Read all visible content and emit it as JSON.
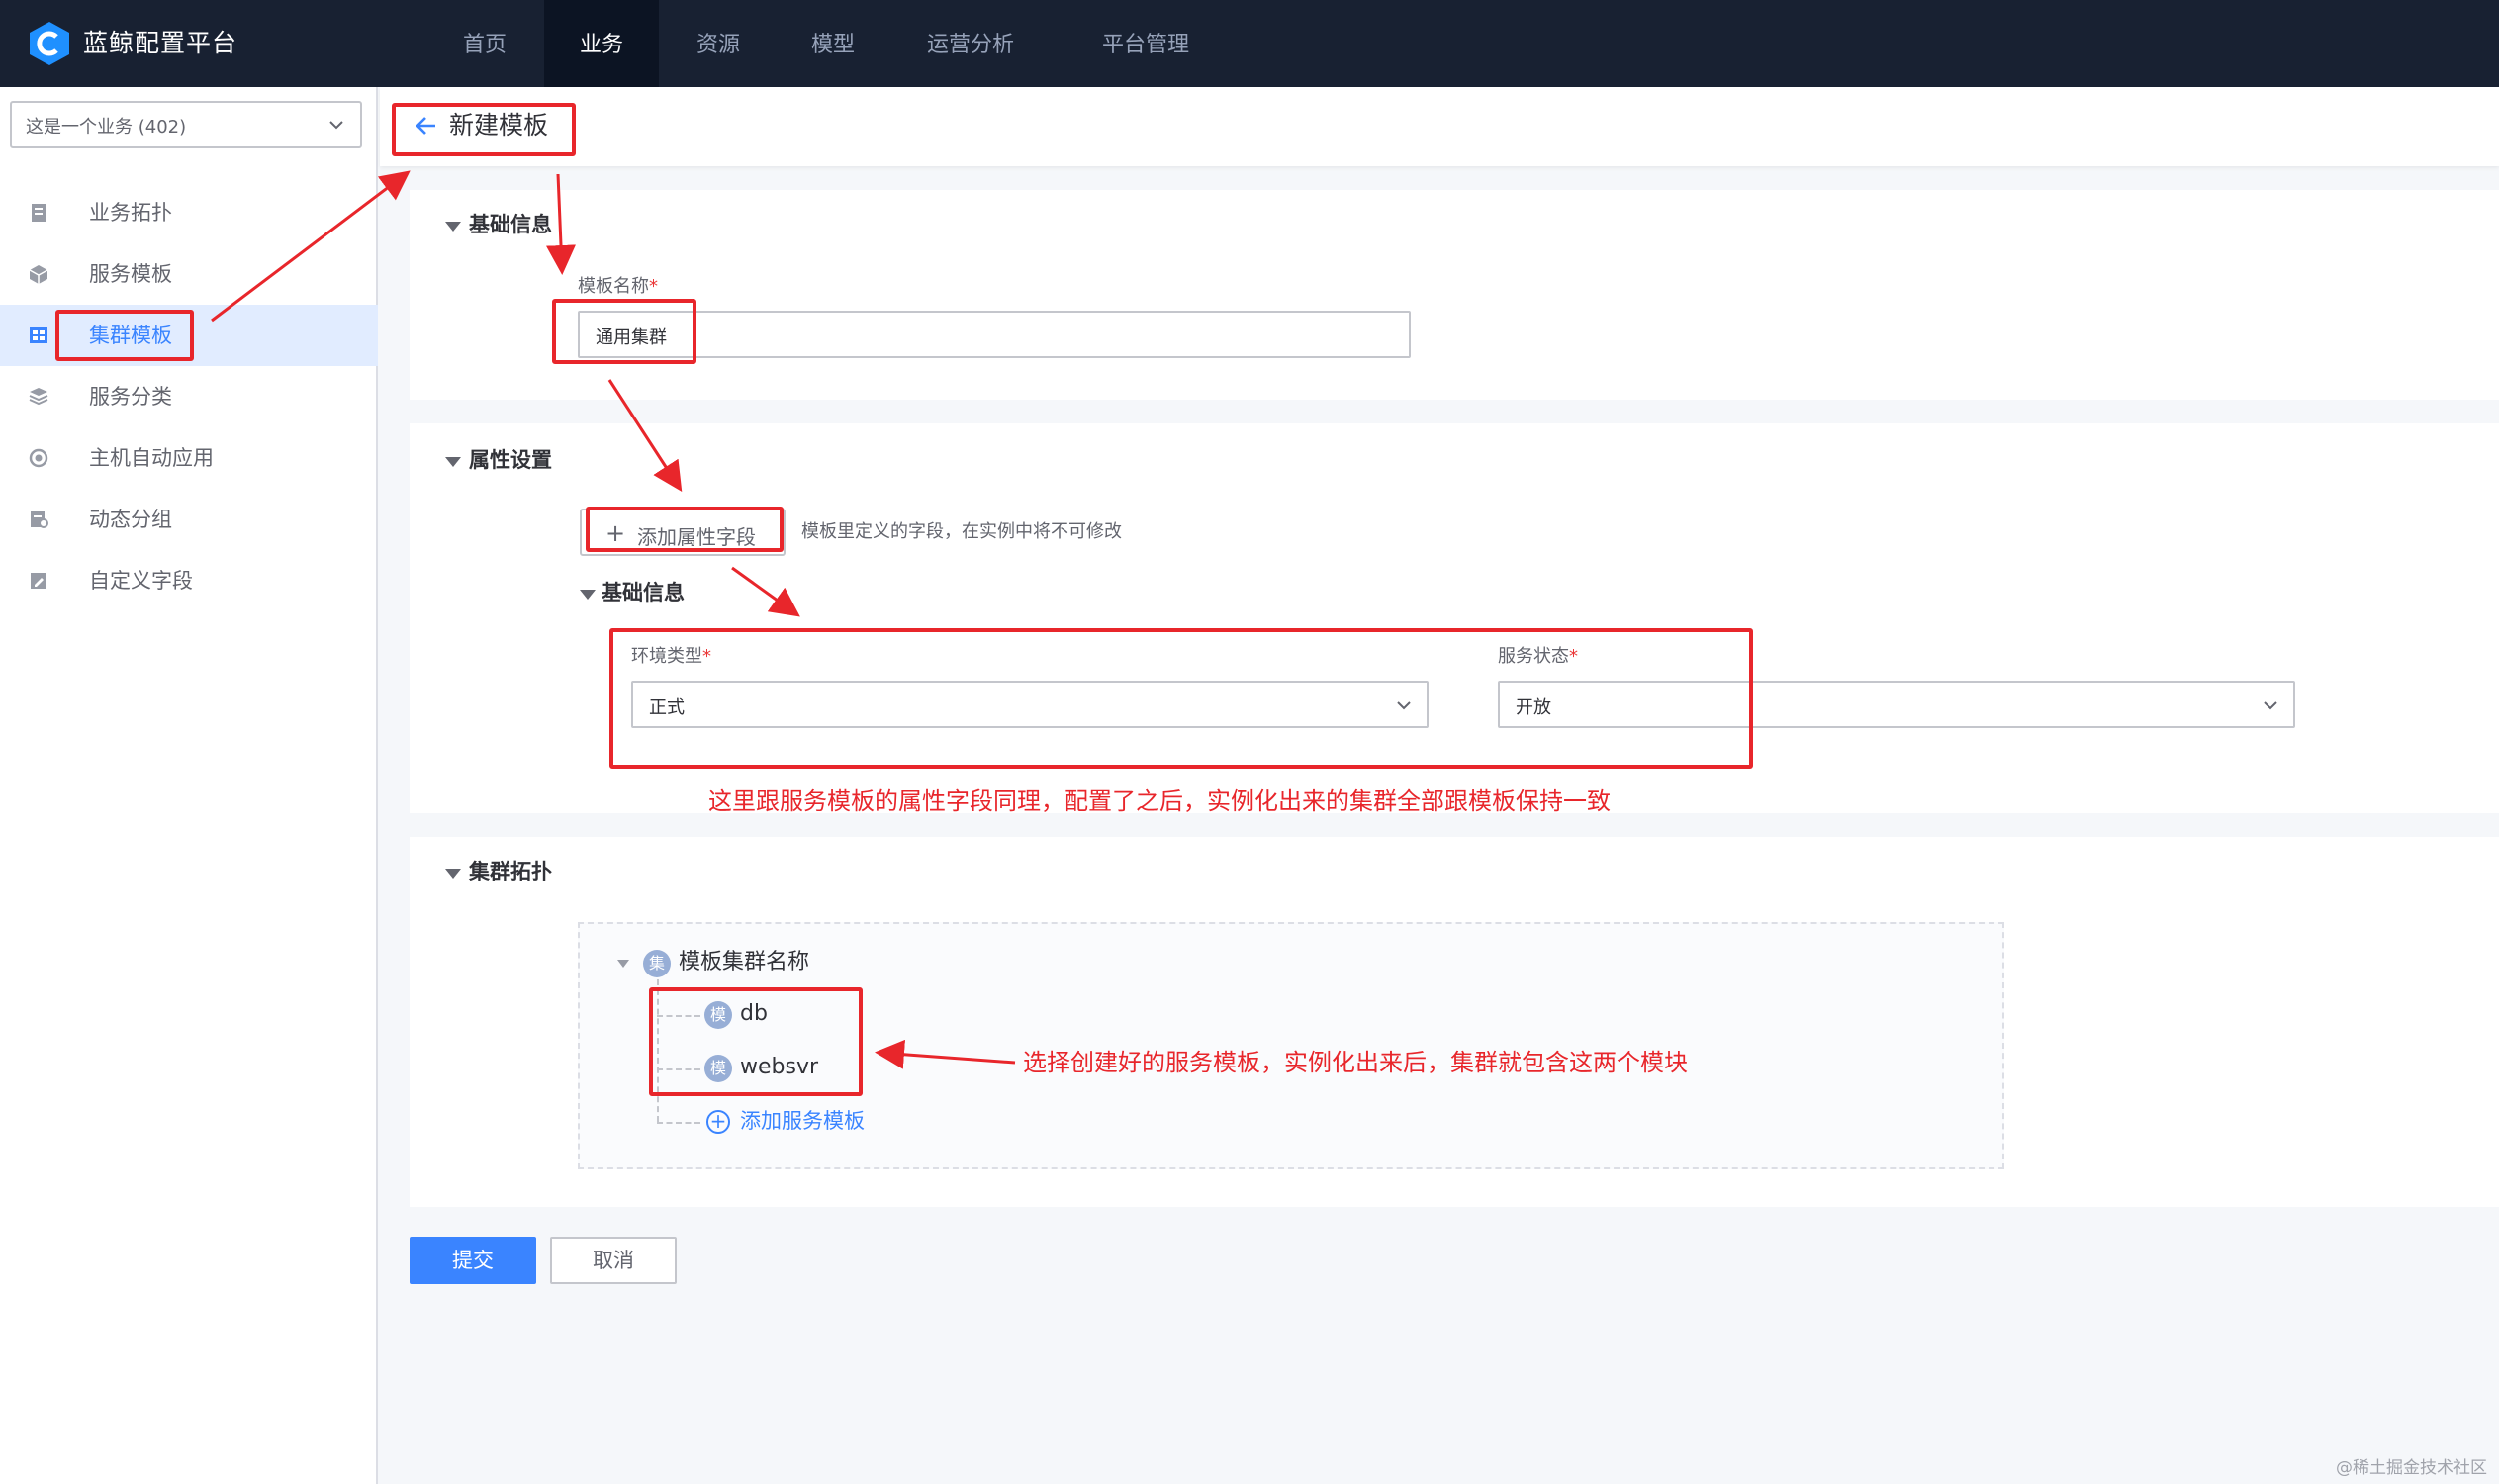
{
  "nav": {
    "brand": "蓝鲸配置平台",
    "items": [
      "首页",
      "业务",
      "资源",
      "模型",
      "运营分析",
      "平台管理"
    ],
    "active": "业务"
  },
  "sidebar": {
    "business_select": "这是一个业务 (402)",
    "items": [
      {
        "label": "业务拓扑",
        "icon": "topology-icon"
      },
      {
        "label": "服务模板",
        "icon": "cube-icon"
      },
      {
        "label": "集群模板",
        "icon": "grid-icon",
        "active": true
      },
      {
        "label": "服务分类",
        "icon": "layers-icon"
      },
      {
        "label": "主机自动应用",
        "icon": "auto-apply-icon"
      },
      {
        "label": "动态分组",
        "icon": "group-icon"
      },
      {
        "label": "自定义字段",
        "icon": "edit-field-icon"
      }
    ]
  },
  "header": {
    "title": "新建模板"
  },
  "basic": {
    "title": "基础信息",
    "name_label": "模板名称",
    "name_value": "通用集群"
  },
  "attributes": {
    "title": "属性设置",
    "add_button": "添加属性字段",
    "hint": "模板里定义的字段，在实例中将不可修改",
    "group_title": "基础信息",
    "env_label": "环境类型",
    "env_value": "正式",
    "status_label": "服务状态",
    "status_value": "开放"
  },
  "topology": {
    "title": "集群拓扑",
    "root_badge": "集",
    "root_name": "模板集群名称",
    "module_badge": "模",
    "modules": [
      "db",
      "websvr"
    ],
    "add_link": "添加服务模板"
  },
  "actions": {
    "submit": "提交",
    "cancel": "取消"
  },
  "annotations": {
    "note1": "这里跟服务模板的属性字段同理，配置了之后，实例化出来的集群全部跟模板保持一致",
    "note2": "选择创建好的服务模板，实例化出来后，集群就包含这两个模块"
  },
  "watermark": "@稀土掘金技术社区",
  "colors": {
    "accent": "#3a84ff",
    "nav_bg": "#182132",
    "annotation": "#e8262b"
  }
}
